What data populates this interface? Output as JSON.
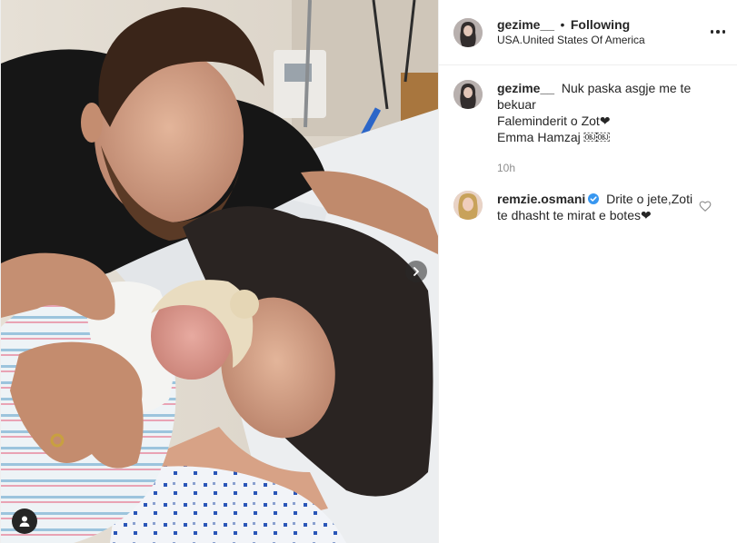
{
  "post": {
    "author": {
      "username": "gezime__",
      "separator": "•",
      "follow_status": "Following",
      "location": "USA.United States Of America"
    },
    "caption": {
      "username": "gezime__",
      "lines": [
        "Nuk paska asgje me te",
        "bekuar",
        "Faleminderit o Zot❤",
        "Emma Hamzaj ￼￼"
      ],
      "time": "10h"
    },
    "comments": [
      {
        "username": "remzie.osmani",
        "verified": true,
        "text": "Drite o jete,Zoti te dhasht te mirat e botes❤"
      }
    ]
  },
  "icons": {
    "more": "more-options-icon",
    "next": "chevron-right-icon",
    "user_tags": "user-tag-icon",
    "like": "heart-outline-icon",
    "verified": "verified-badge-icon"
  },
  "colors": {
    "verified_blue": "#3897f0",
    "secondary_text": "#8e8e8e",
    "divider": "#efefef"
  }
}
